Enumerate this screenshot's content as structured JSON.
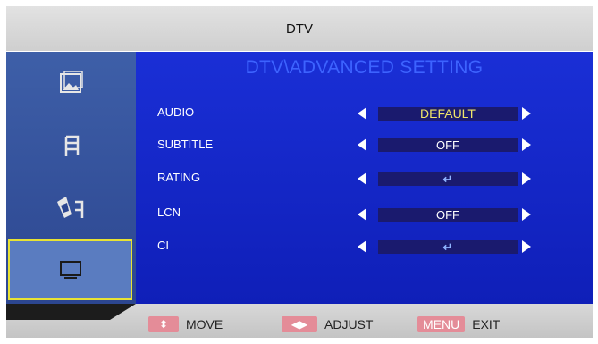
{
  "header": {
    "title": "DTV"
  },
  "sidebar": {
    "items": [
      {
        "icon": "picture-icon"
      },
      {
        "icon": "sound-icon"
      },
      {
        "icon": "setup-icon"
      },
      {
        "icon": "screen-icon",
        "selected": true
      }
    ]
  },
  "panel": {
    "title": "DTV\\ADVANCED SETTING",
    "rows": [
      {
        "label": "AUDIO",
        "value": "DEFAULT"
      },
      {
        "label": "SUBTITLE",
        "value": "OFF"
      },
      {
        "label": "RATING",
        "value": "↵"
      },
      {
        "label": "LCN",
        "value": "OFF"
      },
      {
        "label": "CI",
        "value": "↵"
      }
    ]
  },
  "footer": {
    "move_key": "⬍",
    "move_label": "MOVE",
    "adjust_key": "◀▶",
    "adjust_label": "ADJUST",
    "menu_key": "MENU",
    "exit_label": "EXIT"
  },
  "colors": {
    "accent": "#1a2fd6",
    "title": "#3d63ff",
    "selected_border": "#e8e334",
    "default_value": "#f0e66a"
  }
}
